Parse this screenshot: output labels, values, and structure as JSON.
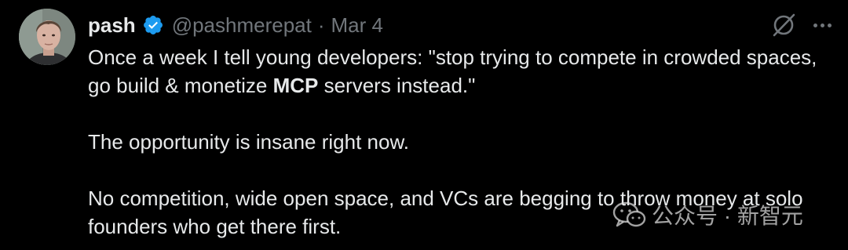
{
  "tweet": {
    "author": {
      "display_name": "pash",
      "verified": true,
      "handle": "@pashmerepat"
    },
    "separator": "·",
    "date": "Mar 4",
    "body": {
      "p1_part1": "Once a week I tell young developers: \"stop trying to compete in crowded spaces, go build & monetize ",
      "p1_bold": "MCP",
      "p1_part2": " servers instead.\"",
      "p2": "The opportunity is insane right now.",
      "p3": "No competition, wide open space, and VCs are begging to throw money at solo founders who get there first."
    },
    "icons": {
      "verified": "verified-badge-icon",
      "grok": "grok-icon",
      "more": "more-options-icon"
    },
    "colors": {
      "background": "#000000",
      "text": "#e7e9ea",
      "muted": "#71767b",
      "verified": "#1d9bf0"
    }
  },
  "watermark": {
    "text": "公众号 · 新智元",
    "icon": "wechat-icon"
  }
}
